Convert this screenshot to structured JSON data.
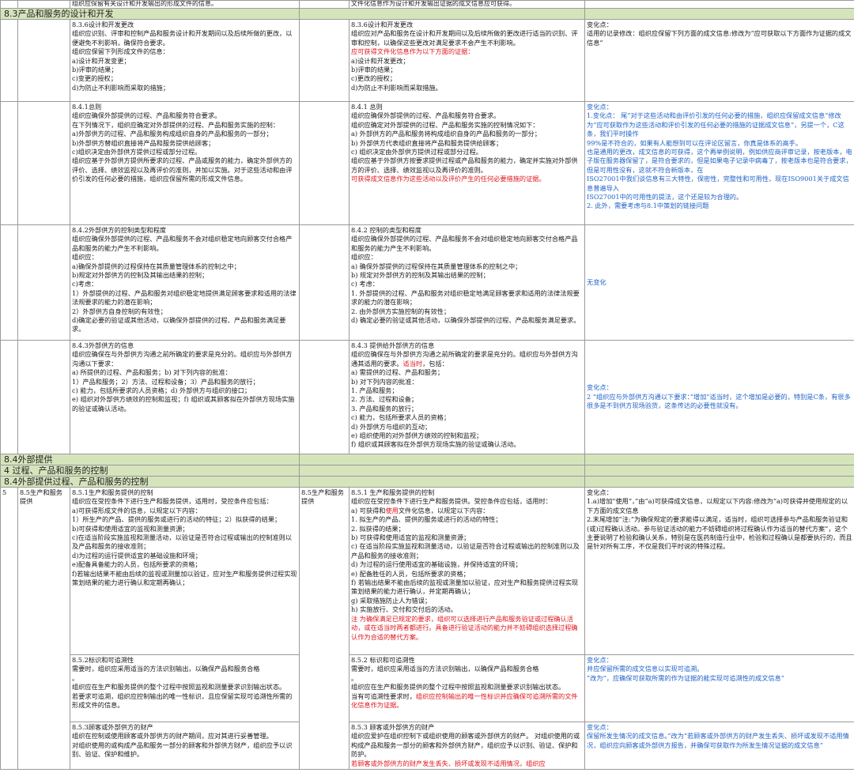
{
  "top_row": {
    "old": "组织应保留有关设计和开发输出的形成文件的信息。",
    "new": "文件化信息作为设计和开发输出证据的成文信息应可获得。"
  },
  "sections": {
    "s83": "8.3产品和服务的设计和开发",
    "s84": "8.4外部提供",
    "s4": "4  过程、产品和服务的控制",
    "s84b": "8.4外部提供过程、产品和服务的控制"
  },
  "rows": [
    {
      "old": "8.3.6设计和开发更改\n组织应识别、评审和控制产品和服务设计和开发期间以及后续所做的更改，以便避免不利影响，确保符合要求。\n组织应保留下列形成文件的信息：\na)设计和开发变更；\nb)评审的结果；\nc)变更的授权；\nd)为防止不利影响而采取的措施；",
      "new": "8.3.6设计和开发更改\n组织应对产品和服务在设计和开发期间以及后续所做的更改进行适当的识别、评审和控制，以确保这些更改对满足要求不会产生不利影响。",
      "new_red": "应可获得文件化信息作为以下方面的证据：",
      "new_tail": "a)设计和开发更改；\nb)评审的结果；\nc)更改的授权；\nd)为防止不利影响而采取措施。",
      "change": "变化点：\n适用的记录修改：组织应保留下列方面的成文信息:修改为“应可获取以下方面作为证据的成文信息”",
      "change_blue": ""
    },
    {
      "old": "8.4.1总则\n组织应确保外部提供的过程、产品和服务符合要求。\n在下列情况下，组织应确定对外部提供的过程、产品和服务实施的控制：\na)外部供方的过程、产品和服务构成组织自身的产品和服务的一部分；\nb)外部供方替组织直接将产品和服务提供给顾客；\nc)组织决定由外部供方提供过程或部分过程。\n组织应基于外部供方提供所要求的过程、产品或服务的能力，确定外部供方的评价、选择、绩效监视以及再评价的准则，并加以实施。对于这些活动和由评价引发的任何必要的措施，组织应保留所需的形成文件信息。",
      "new": "8.4.1 总则\n组织应确保外部提供的过程、产品和服务符合要求。\n组织应确定对外部提供的过程、产品和服务实施的控制情况如下：\na) 外部供方的产品和服务将构成组织自身的产品和服务的一部分；\nb) 外部供方代表组织直接将产品和服务提供给顾客；\nc) 组织决定由外部供方提供过程或部分过程。\n组织应基于外部供方按要求提供过程或产品和服务的能力，确定并实施对外部供方的评价、选择、绩效监视以及再评价的准则。",
      "new_red": "可获得成文信息作为这些活动以及评价产生的任何必要措施的证据。",
      "new_tail": "",
      "change": "",
      "change_blue": "变化点：\n1.变化点： 尾“对于这些活动和由评价引发的任何必要的措施，组织应保留成文信息“修改为”应可获取作为这些活动和评价引发的任何必要的措施的证据成文信息”，另提一个，C这条，我们平时操作\n99%是不符合的，如果有人能想到可以在评论区留言，你真是体系的高手。\n也是通用的更改，成文信息的可获得，这个再举例说明，例如供应商评审记录，按老版本，电子版在服务器保留了，是符合要求的，但是如果电子记录中病毒了，按老版本也是符合要求，但是可用性没有，这就不符合新版本，在\nISO27001中我们谈信息有三大特性，保密性，完整性和可用性，现在ISO9001关于成文信息普遍导入\nISO27001中的可用性的提法，这个还是较为合理的。\n2. 此外，需要考虑与8.1中策划的链接问题"
    },
    {
      "old": "8.4.2外部供方的控制类型和程度\n组织应确保外部提供的过程、产品和服务不会对组织稳定地向顾客交付合格产品和服务的能力产生不利影响。\n组织应：\na)确保外部提供的过程保持在其质量管理体系的控制之中；\nb)规定对外部供方的控制及其输出结果的控制；\nc)考虑：\n1）外部提供的过程、产品和服务对组织稳定地提供满足顾客要求和适用的法律法规要求的能力的潜在影响；\n2）外部供方自身控制的有效性；\nd)确定必要的验证或其他活动，以确保外部提供的过程、产品和服务满足要求。",
      "new": "8.4.2 控制的类型和程度\n组织应确保外部提供的过程、产品和服务不会对组织稳定地向顾客交付合格产品和服务的能力产生不利影响。\n组织应：\na) 确保外部提供的过程保持在其质量管理体系的控制之中；\nb) 规定对外部供方的控制及其输出结果的控制；\nc) 考虑：\n1. 外部提供的过程、产品和服务对组织稳定地满足顾客要求和适用的法律法规要求的能力的潜在影响；\n2. 由外部供方实施控制的有效性；\nd) 确定必要的验证或其他活动，以确保外部提供的过程、产品和服务满足要求。",
      "new_red": "",
      "new_tail": "",
      "change": "",
      "change_blue": "无变化"
    },
    {
      "old": "8.4.3外部供方的信息\n组织应确保在与外部供方沟通之前所确定的要求是充分的。组织应与外部供方沟通以下要求：\na) 所提供的过程、产品和服务；b) 对下列内容的批准：\n1）产品和服务；2）方法、过程和设备；3）产品和服务的放行；\nc) 能力，包括所要求的人员资格；d) 外部供方与组织的接口；\ne) 组织对外部供方绩效的控制和监视；f) 组织或其顾客拟在外部供方现场实施的验证或确认活动。",
      "new": "8.4.3 提供给外部供方的信息\n组织应确保在与外部供方沟通之前所确定的要求是充分的。组织应与外部供方沟通其适用的要求。",
      "new_red": "适当时",
      "new_tail": "，包括：\na) 需提供的过程、产品和服务；\nb) 对下列内容的批准：\n1. 产品和服务；\n2. 方法、过程和设备；\n3. 产品和服务的放行；\nc) 能力，包括所要求人员的资格；\nd) 外部供方与组织的互动；\ne) 组织使用的对外部供方绩效的控制和监视；\nf) 组织或其顾客拟在外部供方现场实施的验证或确认活动。",
      "change": "",
      "change_blue": "变化点：\n2 “组织应与外部供方沟通以下要求：”增加”适当时，这个增加是必要的，特别是C条，有很多很多是不到供方现场验货，这条传达的必要性就没有。"
    }
  ],
  "row85": {
    "num": "5",
    "old_sec": "8.5生产和服务提供",
    "old": "8.5.1生产和服务提供的控制\n组织应在受控条件下进行生产和服务提供，适用时，受控条件应包括：\na)可获得形成文件的信息，以规定以下内容：\n1）所生产的产品、提供的服务或进行的活动的特征；2）拟获得的结果；\nb)可获得和使用适宜的监视和测量资源；\nc)在适当阶段实施监视和测量活动，以验证是否符合过程或输出的控制准则以及产品和服务的接收准则；\nd)为过程的运行提供适宜的基础设施和环境；\ne)配备具备能力的人员，包括所要求的资格；\nf)若输出结果不能由后续的监视或测量加以验证，应对生产和服务提供过程实现策划结果的能力进行确认和定期再确认；",
    "new_sec": "8.5生产和服务提供",
    "new": "8.5.1 生产和服务提供的控制\n组织应在受控条件下进行生产和服务提供。受控条件应包括，适用时：\na) 可获得和",
    "new_red1": "使用",
    "new_mid": "文件化信息，以规定以下内容：\n1. 拟生产的产品、提供的服务或进行的活动的特性；\n2. 拟获得的结果；\nb) 可获得和使用适宜的监视和测量资源；\nc) 在适当阶段实施监视和测量活动，以验证是否符合过程或输出的控制准则以及产品和服务的接收准则；\nd) 为过程的运行使用适宜的基础设施，并保持适宜的环境；\ne) 配备胜任的人员，包括所要求的资格；\nf) 若输出结果不能由后续的监视或测量加以验证，应对生产和服务提供过程实现策划结果的能力进行确认，并定期再确认；\ng) 采取措施防止人为错误；\nh) 实施放行、交付和交付后的活动。",
    "new_red2": "注 为确保满足已规定的要求，组织可以选择进行产品和服务验证或过程确认活动，或在适当时两者都进行。具备进行验证活动的能力并不妨碍组织选择过程确认作为合适的替代方案。",
    "change": "变化点：\n1.a)增加”使用“，”由”a)可获得成文信息，以规定以下内容:修改为”a)可获得并使用规定的以下方面的成文信息\n2.末尾增加”注:”为确保规定的要求能得以满足，适当时，组织可选择参与产品和服务验证和(或)过程确认活动。参与验证活动的能力不妨碍组织将过程确认作为适当的替代方案”，这个主要说明了检验和确认关系，特别是在医药制造行业中，检验和过程确认是都要执行的，而且是针对所有工序，不仅是我们平时说的特殊过程。"
  },
  "row852": {
    "old": "8.5.2标识和可追溯性\n需要时，组织应采用适当的方法识别输出，以确保产品和服务合格\n。\n组织应在生产和服务提供的整个过程中按照监视和测量要求识别输出状态。\n若要求可追溯，组织应控制输出的唯一性标识，且应保留实现可追溯性所需的形成文件的信息。",
    "new": "8.5.2 标识和可追溯性\n需要时，组织应采用适当的方法识别输出，以确保产品和服务合格\n。\n组织应在生产和服务提供的整个过程中按照监视和测量要求识别输出状态。\n当有可追溯性要求时，",
    "new_red": "组织应控制输出的唯一性标识并应确保可追溯所需的文件化信息作为证据。",
    "change_blue": "变化点：\n并应保留所需的成文信息以实现可追溯。\n”改为“，应确保可获取所需的作为证据的能实现可追溯性的成文信息”"
  },
  "row853": {
    "old": "8.5.3顾客或外部供方的财产\n组织在控制或使用顾客或外部供方的财产期间，应对其进行妥善管理。\n对组织使用的或构成产品和服务一部分的顾客和外部供方财产，组织应予以识别、验证、保护和维护。",
    "new": "8.5.3 顾客或外部供方的财产\n组织应爱护在组织控制下或组织使用的顾客或外部供方的财产。 对组织使用的或构成产品和服务一部分的顾客和外部供方财产，组织应予以识别、验证、保护和防护。",
    "new_red": "若顾客或外部供方的财产发生丢失、损坏或发现不适用情况，组织应",
    "change_blue": "变化点：\n保留所发生情况的成文信息。”改为“若顾客或外部供方的财产发生丢失、损坏或发现不适用情况，组织应向顾客或外部供方报告，并确保可获取作为所发生情况证据的成文信息”"
  }
}
